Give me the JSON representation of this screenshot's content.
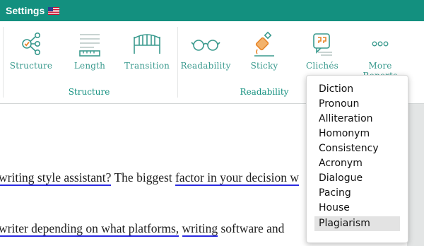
{
  "header": {
    "title": "Settings",
    "flag_icon": "us-flag-icon"
  },
  "toolbar": {
    "tools": [
      {
        "label": "Structure",
        "icon": "structure-icon"
      },
      {
        "label": "Length",
        "icon": "length-icon"
      },
      {
        "label": "Transition",
        "icon": "transition-icon"
      },
      {
        "label": "Readability",
        "icon": "readability-icon"
      },
      {
        "label": "Sticky",
        "icon": "sticky-icon"
      },
      {
        "label": "Clichés",
        "icon": "cliches-icon"
      },
      {
        "label": "More Reports",
        "icon": "more-icon"
      }
    ],
    "groups": [
      {
        "label": "Structure"
      },
      {
        "label": "Readability"
      }
    ]
  },
  "editor": {
    "line1": {
      "seg1": "writing style assistant?",
      "seg2": " The biggest ",
      "seg3": "factor in your decision w"
    },
    "line2": {
      "seg1": "writer depending on what platforms,",
      "seg2": " ",
      "seg3": "writing",
      "seg4": " software and"
    }
  },
  "dropdown": {
    "items": [
      "Diction",
      "Pronoun",
      "Alliteration",
      "Homonym",
      "Consistency",
      "Acronym",
      "Dialogue",
      "Pacing",
      "House",
      "Plagiarism"
    ],
    "highlighted": "Plagiarism"
  },
  "colors": {
    "brand": "#13907f",
    "icon": "#3a9a8e",
    "underline": "#2a2ae0"
  }
}
